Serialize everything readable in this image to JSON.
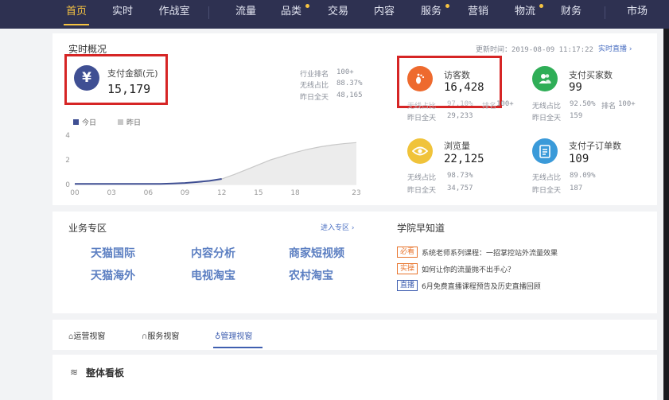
{
  "nav": {
    "items": [
      "首页",
      "实时",
      "作战室",
      "流量",
      "品类",
      "交易",
      "内容",
      "服务",
      "营销",
      "物流",
      "财务",
      "市场"
    ]
  },
  "realtime": {
    "title": "实时概况",
    "update_label": "更新时间：",
    "update_time": "2019-08-09 11:17:22",
    "live_link": "实时直播 ›",
    "pay_amount": {
      "label": "支付金额(元)",
      "value": "15,179",
      "industry_rank_label": "行业排名",
      "industry_rank": "100+",
      "wireless_label": "无线占比",
      "wireless": "88.37%",
      "yesterday_label": "昨日全天",
      "yesterday": "48,165"
    },
    "legend": {
      "today": "今日",
      "yesterday": "昨日"
    },
    "chart_data": {
      "type": "line",
      "x_ticks": [
        "00",
        "03",
        "06",
        "09",
        "12",
        "15",
        "18",
        "23"
      ],
      "y_ticks": [
        "4",
        "2",
        "0"
      ],
      "series": [
        {
          "name": "今日",
          "x": [
            0,
            1,
            2,
            3,
            4,
            5,
            6,
            7,
            8,
            9,
            10,
            11,
            12
          ],
          "y": [
            0.05,
            0.05,
            0.05,
            0.05,
            0.05,
            0.05,
            0.05,
            0.05,
            0.08,
            0.12,
            0.2,
            0.3,
            0.45
          ]
        },
        {
          "name": "昨日",
          "x": [
            0,
            1,
            2,
            3,
            4,
            5,
            6,
            7,
            8,
            9,
            10,
            11,
            12,
            13,
            14,
            15,
            16,
            17,
            18,
            19,
            20,
            21,
            22,
            23
          ],
          "y": [
            0.05,
            0.05,
            0.05,
            0.05,
            0.05,
            0.05,
            0.05,
            0.05,
            0.08,
            0.12,
            0.2,
            0.3,
            0.45,
            0.8,
            1.2,
            1.6,
            2.0,
            2.3,
            2.6,
            2.85,
            3.05,
            3.2,
            3.32,
            3.4
          ]
        }
      ],
      "ylim": [
        0,
        4
      ]
    },
    "visitors": {
      "label": "访客数",
      "value": "16,428",
      "wireless_label": "无线占比",
      "wireless": "97.10%",
      "rank_label": "排名",
      "rank": "100+",
      "yesterday_label": "昨日全天",
      "yesterday": "29,233"
    },
    "buyers": {
      "label": "支付买家数",
      "value": "99",
      "wireless_label": "无线占比",
      "wireless": "92.50%",
      "rank_label": "排名",
      "rank": "100+",
      "yesterday_label": "昨日全天",
      "yesterday": "159"
    },
    "views": {
      "label": "浏览量",
      "value": "22,125",
      "wireless_label": "无线占比",
      "wireless": "98.73%",
      "yesterday_label": "昨日全天",
      "yesterday": "34,757"
    },
    "orders": {
      "label": "支付子订单数",
      "value": "109",
      "wireless_label": "无线占比",
      "wireless": "89.09%",
      "yesterday_label": "昨日全天",
      "yesterday": "187"
    }
  },
  "biz": {
    "title": "业务专区",
    "enter_link": "进入专区 ›",
    "links": [
      "天猫国际",
      "内容分析",
      "商家短视频",
      "天猫海外",
      "电视淘宝",
      "农村淘宝"
    ]
  },
  "academy": {
    "title": "学院早知道",
    "items": [
      {
        "tag": "必看",
        "text": "系统老师系列课程：一招掌控站外流量效果"
      },
      {
        "tag": "实操",
        "text": "如何让你的流量抛不出手心？"
      },
      {
        "tag": "直播",
        "text": "6月免费直播课程预告及历史直播回顾"
      }
    ]
  },
  "tabs": [
    "运营视窗",
    "服务视窗",
    "管理视窗"
  ],
  "board": {
    "title": "整体看板"
  },
  "colors": {
    "nav_bg": "#2e3151",
    "accent": "#f5c342",
    "pay_icon": "#3f4f93",
    "visitor_icon": "#ee6a2e",
    "buyer_icon": "#2fae57",
    "view_icon": "#f0c33a",
    "order_icon": "#3a9ad9"
  },
  "icons": {
    "pay": "yuan-icon",
    "visitors": "footprint-icon",
    "buyers": "users-icon",
    "views": "eye-icon",
    "orders": "document-icon"
  }
}
